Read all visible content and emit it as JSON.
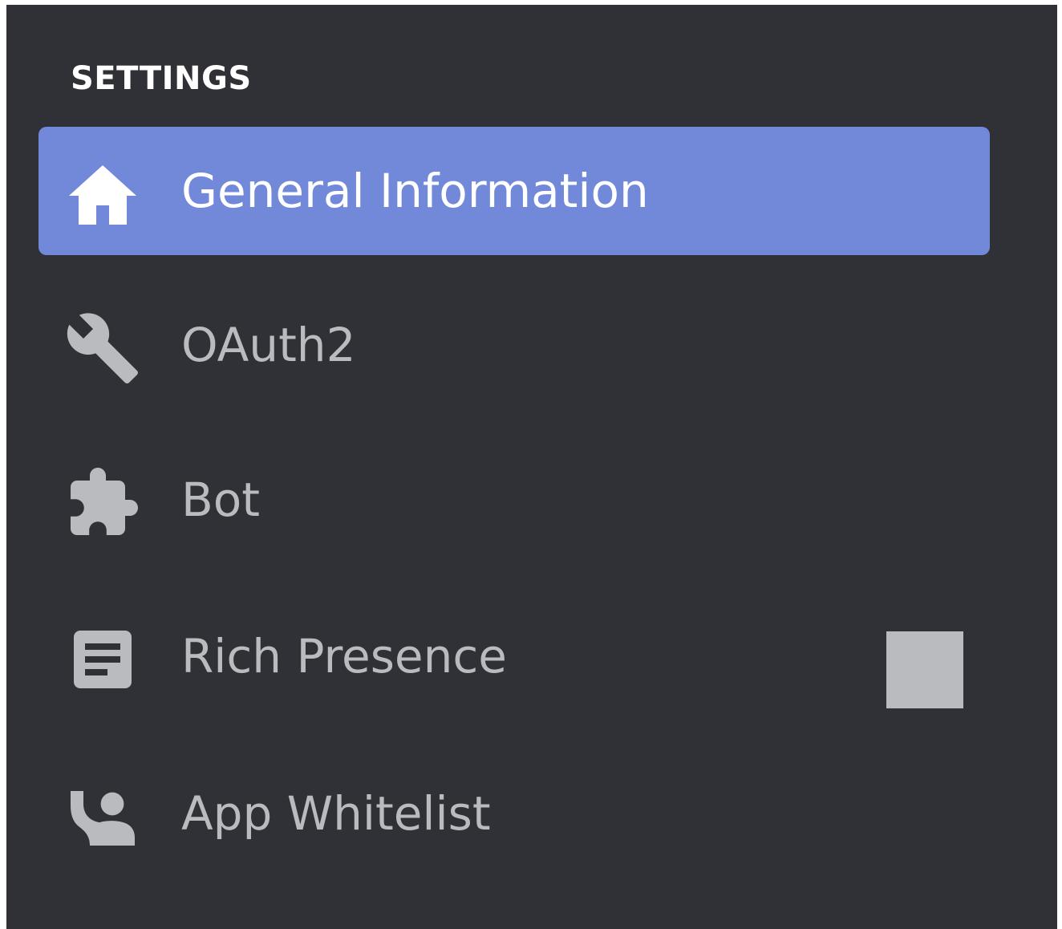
{
  "sidebar": {
    "section_title": "SETTINGS",
    "items": [
      {
        "label": "General Information",
        "icon": "home-icon",
        "active": true
      },
      {
        "label": "OAuth2",
        "icon": "wrench-icon",
        "active": false
      },
      {
        "label": "Bot",
        "icon": "puzzle-icon",
        "active": false
      },
      {
        "label": "Rich Presence",
        "icon": "document-icon",
        "active": false
      },
      {
        "label": "App Whitelist",
        "icon": "person-whitelist-icon",
        "active": false
      }
    ]
  },
  "colors": {
    "background": "#2f3136",
    "active_item": "#7289da",
    "active_text": "#ffffff",
    "inactive_text": "#b9bbbe"
  }
}
